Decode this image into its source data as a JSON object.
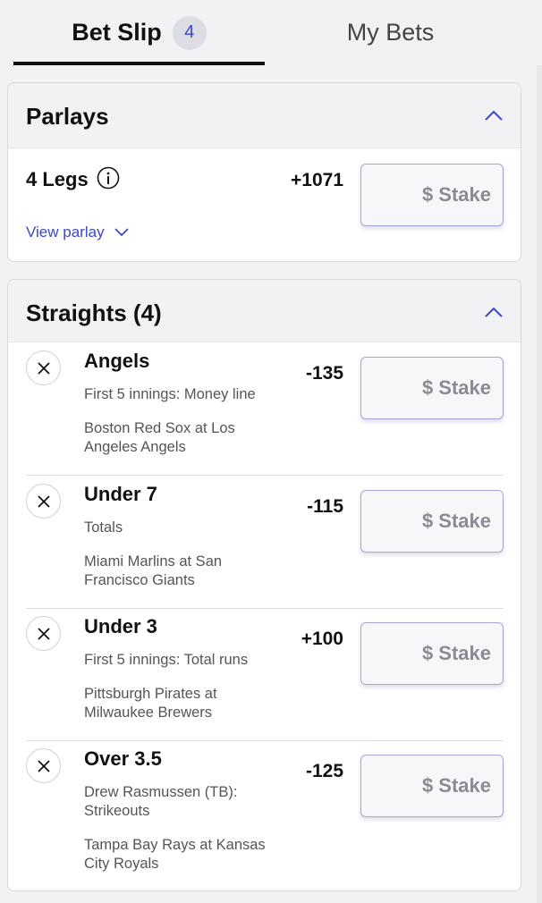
{
  "tabs": {
    "bet_slip": "Bet Slip",
    "bet_slip_count": "4",
    "my_bets": "My Bets"
  },
  "parlays": {
    "title": "Parlays",
    "legs_label": "4 Legs",
    "odds": "+1071",
    "stake_placeholder": "$ Stake",
    "view_parlay": "View parlay"
  },
  "straights": {
    "title": "Straights (4)",
    "bets": [
      {
        "title": "Angels",
        "market": "First 5 innings: Money line",
        "game": "Boston Red Sox at Los Angeles Angels",
        "odds": "-135",
        "stake_placeholder": "$ Stake"
      },
      {
        "title": "Under 7",
        "market": "Totals",
        "game": "Miami Marlins at San Francisco Giants",
        "odds": "-115",
        "stake_placeholder": "$ Stake"
      },
      {
        "title": "Under 3",
        "market": "First 5 innings: Total runs",
        "game": "Pittsburgh Pirates at Milwaukee Brewers",
        "odds": "+100",
        "stake_placeholder": "$ Stake"
      },
      {
        "title": "Over 3.5",
        "market": "Drew Rasmussen (TB): Strikeouts",
        "game": "Tampa Bay Rays at Kansas City Royals",
        "odds": "-125",
        "stake_placeholder": "$ Stake"
      }
    ]
  },
  "colors": {
    "accent": "#3a48c9",
    "stake_border": "#a6a6d6",
    "header_bg": "#f2f2f4"
  },
  "icons": {
    "collapse": "chevron-up-icon",
    "info": "info-icon",
    "expand": "chevron-down-icon",
    "remove": "close-icon"
  }
}
